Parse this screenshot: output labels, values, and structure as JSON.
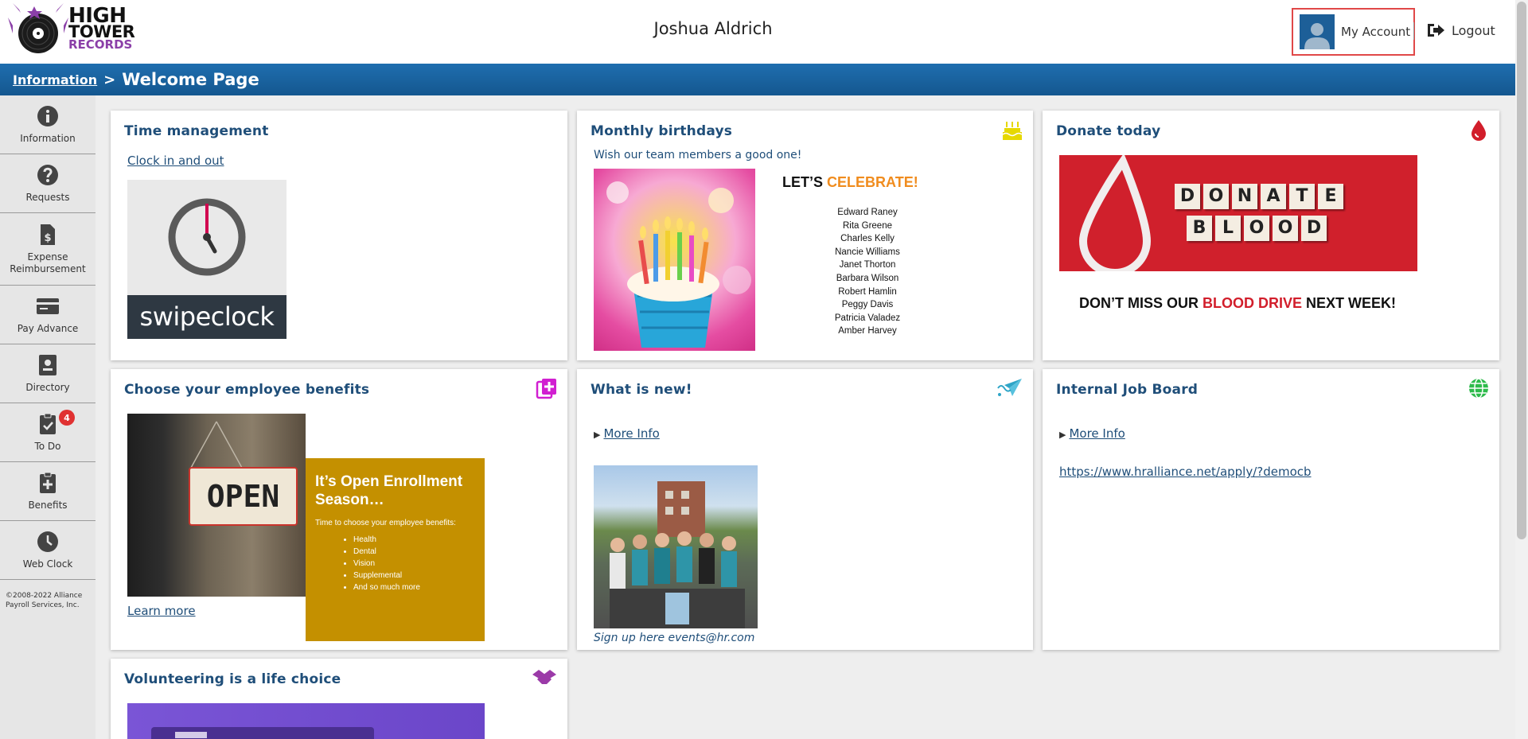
{
  "header": {
    "logo_text": [
      "HIGH",
      "TOWER",
      "RECORDS"
    ],
    "user_name": "Joshua Aldrich",
    "my_account_label": "My Account",
    "logout_label": "Logout"
  },
  "breadcrumb": {
    "parent": "Information",
    "separator": ">",
    "current": "Welcome Page"
  },
  "sidebar": {
    "items": [
      {
        "label": "Information",
        "icon": "info-icon"
      },
      {
        "label": "Requests",
        "icon": "question-icon"
      },
      {
        "label": "Expense Reimbursement",
        "icon": "receipt-dollar-icon"
      },
      {
        "label": "Pay Advance",
        "icon": "credit-card-icon"
      },
      {
        "label": "Directory",
        "icon": "contact-card-icon"
      },
      {
        "label": "To Do",
        "icon": "clipboard-check-icon",
        "badge": "4"
      },
      {
        "label": "Benefits",
        "icon": "clipboard-plus-icon"
      },
      {
        "label": "Web Clock",
        "icon": "clock-icon"
      }
    ],
    "copyright": "©2008-2022 Alliance Payroll Services, Inc."
  },
  "cards": {
    "time": {
      "title": "Time management",
      "link": "Clock in and out",
      "brand": "swipeclock"
    },
    "birthdays": {
      "title": "Monthly birthdays",
      "subtitle": "Wish our team members a good one!",
      "celebrate_prefix": "LET’S",
      "celebrate_word": "CELEBRATE!",
      "names": [
        "Edward Raney",
        "Rita Greene",
        "Charles Kelly",
        "Nancie Williams",
        "Janet Thorton",
        "Barbara Wilson",
        "Robert Hamlin",
        "Peggy Davis",
        "Patricia Valadez",
        "Amber Harvey"
      ]
    },
    "donate": {
      "title": "Donate today",
      "tiles_row1": [
        "D",
        "O",
        "N",
        "A",
        "T",
        "E"
      ],
      "tiles_row2": [
        "B",
        "L",
        "O",
        "O",
        "D"
      ],
      "banner_prefix": "DON’T MISS OUR",
      "banner_highlight": "BLOOD DRIVE",
      "banner_suffix": "NEXT WEEK!"
    },
    "benefits": {
      "title": "Choose your employee benefits",
      "sign_text": "OPEN",
      "enroll_heading": "It’s Open Enrollment Season…",
      "enroll_text": "Time to choose your employee benefits:",
      "enroll_items": [
        "Health",
        "Dental",
        "Vision",
        "Supplemental",
        "And so much more"
      ],
      "link": "Learn more"
    },
    "whatsnew": {
      "title": "What is new!",
      "more_info": "More Info",
      "caption": "Sign up here events@hr.com"
    },
    "jobs": {
      "title": "Internal Job Board",
      "more_info": "More Info",
      "url": "https://www.hralliance.net/apply/?democb"
    },
    "volunteer": {
      "title": "Volunteering is a life choice"
    }
  },
  "colors": {
    "header_blue": "#1a639f",
    "title_blue": "#1f4e79",
    "celebrate_orange": "#f08c1e",
    "blood_red": "#d21e2b",
    "enroll_gold": "#c49000",
    "badge_red": "#e03131"
  }
}
